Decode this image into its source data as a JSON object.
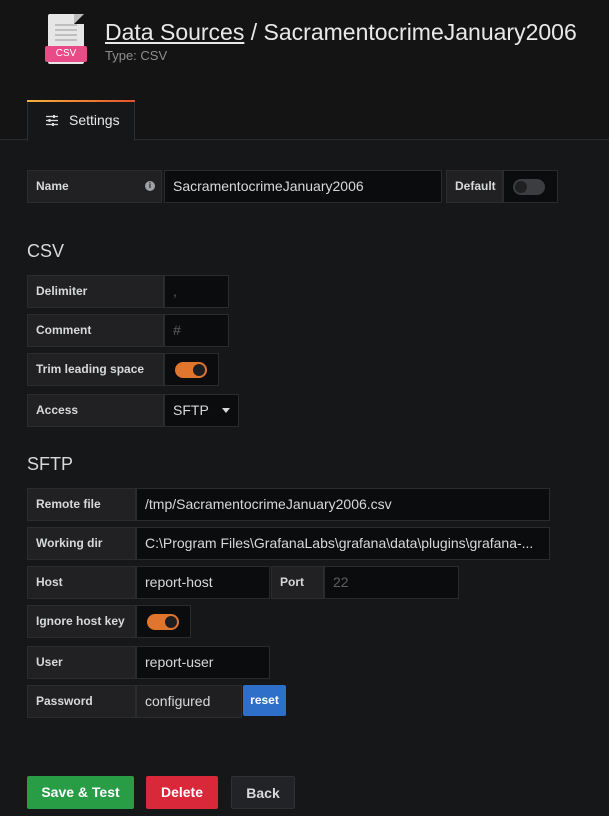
{
  "header": {
    "breadcrumb_link": "Data Sources",
    "separator": " / ",
    "datasource_name": "SacramentocrimeJanuary2006",
    "subtitle": "Type: CSV",
    "icon_tag": "CSV",
    "icon": "csv-file-icon"
  },
  "tabs": [
    {
      "label": "Settings",
      "icon": "sliders-icon",
      "active": true
    }
  ],
  "general": {
    "name_label": "Name",
    "name_value": "SacramentocrimeJanuary2006",
    "default_label": "Default",
    "default_on": false
  },
  "csv": {
    "title": "CSV",
    "delimiter_label": "Delimiter",
    "delimiter_placeholder": ",",
    "comment_label": "Comment",
    "comment_placeholder": "#",
    "trim_label": "Trim leading space",
    "trim_on": true,
    "access_label": "Access",
    "access_value": "SFTP"
  },
  "sftp": {
    "title": "SFTP",
    "remote_file_label": "Remote file",
    "remote_file_value": "/tmp/SacramentocrimeJanuary2006.csv",
    "working_dir_label": "Working dir",
    "working_dir_value": "C:\\Program Files\\GrafanaLabs\\grafana\\data\\plugins\\grafana-...",
    "host_label": "Host",
    "host_value": "report-host",
    "port_label": "Port",
    "port_placeholder": "22",
    "ignore_host_key_label": "Ignore host key",
    "ignore_host_key_on": true,
    "user_label": "User",
    "user_value": "report-user",
    "password_label": "Password",
    "password_value": "configured",
    "reset_label": "reset"
  },
  "actions": {
    "save_label": "Save & Test",
    "delete_label": "Delete",
    "back_label": "Back"
  },
  "colors": {
    "accent_orange": "#e0752d",
    "save_green": "#299c46",
    "delete_red": "#d8283a",
    "reset_blue": "#2e6fc9",
    "csv_pink": "#e94b86"
  }
}
